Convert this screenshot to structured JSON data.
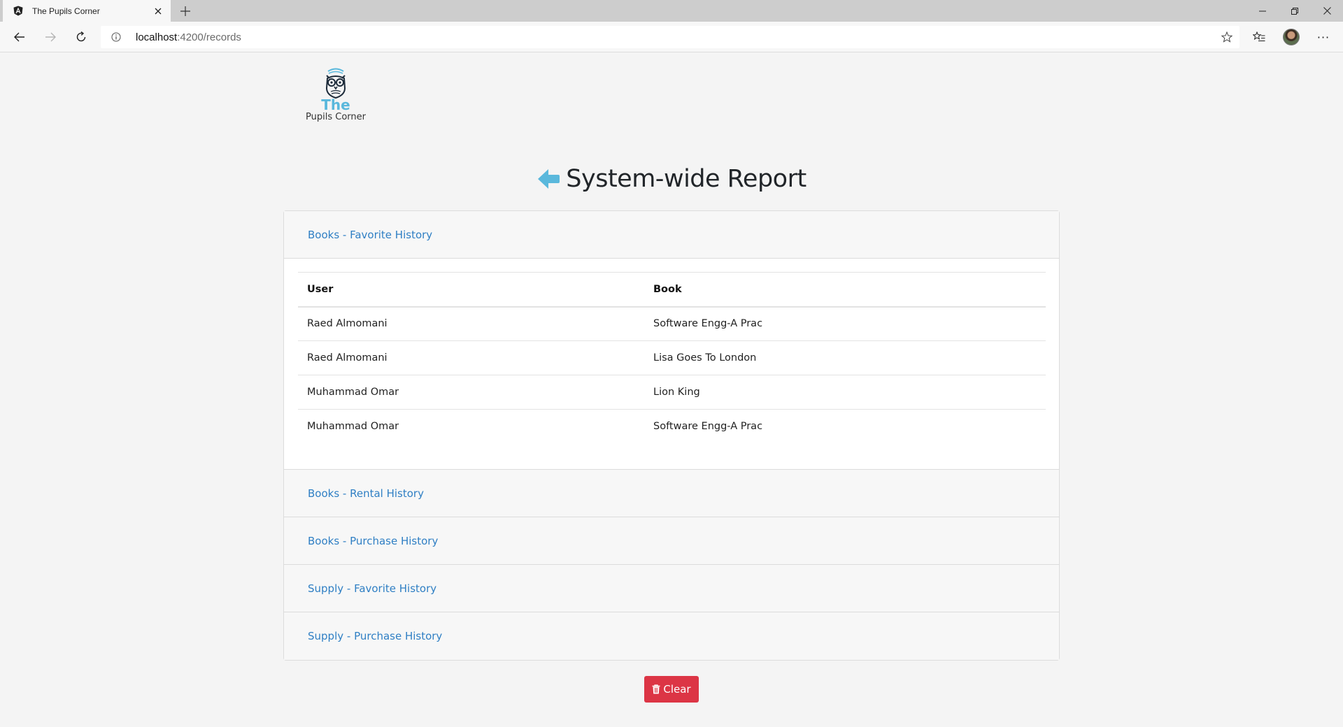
{
  "browser": {
    "tab_title": "The Pupils Corner",
    "url_host": "localhost",
    "url_path": ":4200/records",
    "more_label": "···"
  },
  "logo": {
    "line1": "The",
    "line2": "Pupils Corner"
  },
  "page": {
    "title": "System-wide Report",
    "clear_label": "Clear"
  },
  "sections": [
    {
      "label": "Books - Favorite History",
      "expanded": true
    },
    {
      "label": "Books - Rental History",
      "expanded": false
    },
    {
      "label": "Books - Purchase History",
      "expanded": false
    },
    {
      "label": "Supply - Favorite History",
      "expanded": false
    },
    {
      "label": "Supply - Purchase History",
      "expanded": false
    }
  ],
  "favorites_table": {
    "headers": [
      "User",
      "Book"
    ],
    "rows": [
      [
        "Raed Almomani",
        "Software Engg-A Prac"
      ],
      [
        "Raed Almomani",
        "Lisa Goes To London"
      ],
      [
        "Muhammad Omar",
        "Lion King"
      ],
      [
        "Muhammad Omar",
        "Software Engg-A Prac"
      ]
    ]
  },
  "colors": {
    "link": "#2f7fc4",
    "accent": "#5ab8dc",
    "danger": "#dc3545"
  }
}
